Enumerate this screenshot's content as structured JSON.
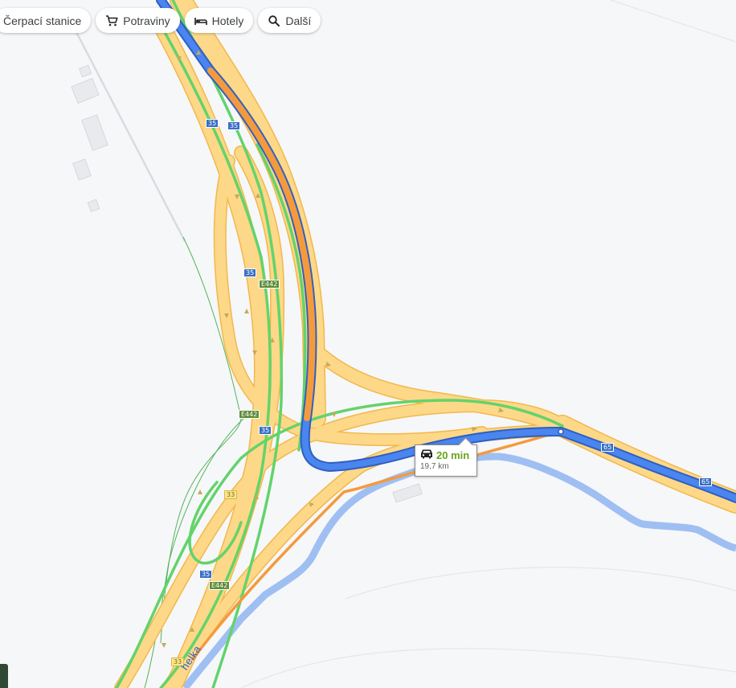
{
  "filter_chips": [
    {
      "label": "Čerpací stanice",
      "icon": "gas-station-icon"
    },
    {
      "label": "Potraviny",
      "icon": "shopping-cart-icon"
    },
    {
      "label": "Hotely",
      "icon": "hotel-bed-icon"
    },
    {
      "label": "Další",
      "icon": "search-icon"
    }
  ],
  "route_callout": {
    "icon": "car-icon",
    "duration": "20 min",
    "distance": "19,7 km"
  },
  "road_shields": [
    {
      "label": "35",
      "kind": "blue"
    },
    {
      "label": "35",
      "kind": "blue"
    },
    {
      "label": "35",
      "kind": "blue"
    },
    {
      "label": "E442",
      "kind": "green"
    },
    {
      "label": "E442",
      "kind": "green"
    },
    {
      "label": "35",
      "kind": "blue"
    },
    {
      "label": "33",
      "kind": "yellow"
    },
    {
      "label": "35",
      "kind": "blue"
    },
    {
      "label": "E442",
      "kind": "green"
    },
    {
      "label": "33",
      "kind": "yellow"
    },
    {
      "label": "65",
      "kind": "blue"
    },
    {
      "label": "65",
      "kind": "blue"
    }
  ],
  "river_label": "helka",
  "colors": {
    "map_background": "#f6f7f9",
    "highway": "#fdd888",
    "highway_casing": "#f2b84b",
    "traffic_free": "#63d36b",
    "traffic_slow": "#f59a3c",
    "route": "#4a85f0",
    "route_casing": "#2f5fc0",
    "river": "#9fbff3"
  }
}
